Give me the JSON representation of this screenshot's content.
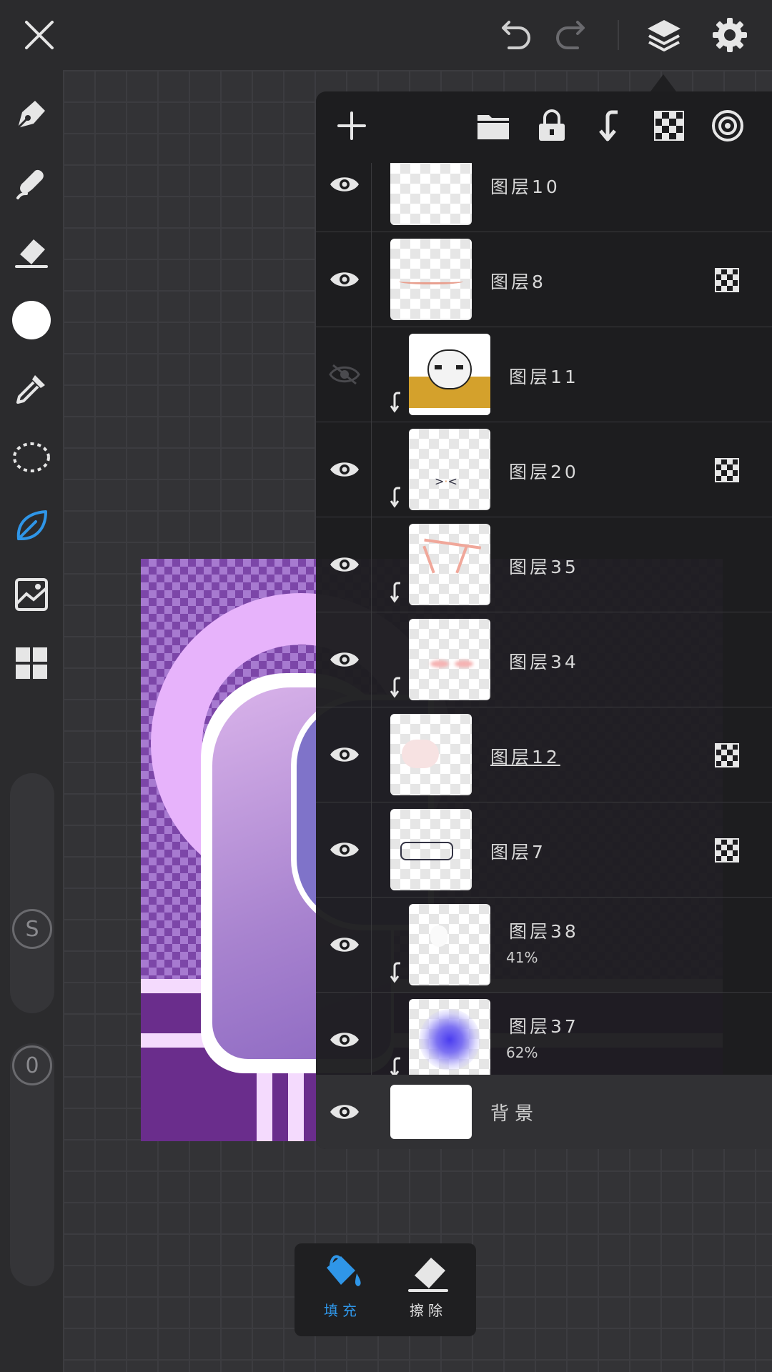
{
  "colors": {
    "accent": "#2f96e8",
    "icon": "#e6e6e6",
    "panel": "#1c1c1e"
  },
  "topbar": {
    "close_icon": "close-icon",
    "undo_icon": "undo-icon",
    "redo_icon": "redo-icon",
    "layers_icon": "layers-icon",
    "settings_icon": "gear-icon"
  },
  "left_tools": [
    "pen-icon",
    "smudge-icon",
    "eraser-icon",
    "color-swatch",
    "eyedropper-icon",
    "lasso-icon",
    "fill-leaf-icon",
    "image-import-icon",
    "grid-icon"
  ],
  "sliders": {
    "size_label": "S",
    "opacity_label": "0"
  },
  "layers_panel": {
    "layers": [
      {
        "name": "图层10",
        "visible": true,
        "clipped": false,
        "alpha_lock": false,
        "opacity": ""
      },
      {
        "name": "图层8",
        "visible": true,
        "clipped": false,
        "alpha_lock": true,
        "opacity": ""
      },
      {
        "name": "图层11",
        "visible": false,
        "clipped": true,
        "alpha_lock": false,
        "opacity": ""
      },
      {
        "name": "图层20",
        "visible": true,
        "clipped": true,
        "alpha_lock": true,
        "opacity": ""
      },
      {
        "name": "图层35",
        "visible": true,
        "clipped": true,
        "alpha_lock": false,
        "opacity": ""
      },
      {
        "name": "图层34",
        "visible": true,
        "clipped": true,
        "alpha_lock": false,
        "opacity": ""
      },
      {
        "name": "图层12",
        "visible": true,
        "clipped": false,
        "alpha_lock": true,
        "opacity": ""
      },
      {
        "name": "图层7",
        "visible": true,
        "clipped": false,
        "alpha_lock": true,
        "opacity": ""
      },
      {
        "name": "图层38",
        "visible": true,
        "clipped": true,
        "alpha_lock": false,
        "opacity": "41%"
      },
      {
        "name": "图层37",
        "visible": true,
        "clipped": true,
        "alpha_lock": false,
        "opacity": "62%"
      }
    ],
    "background": {
      "name": "背景"
    }
  },
  "bottom_tools": {
    "fill_label": "填充",
    "erase_label": "擦除"
  }
}
